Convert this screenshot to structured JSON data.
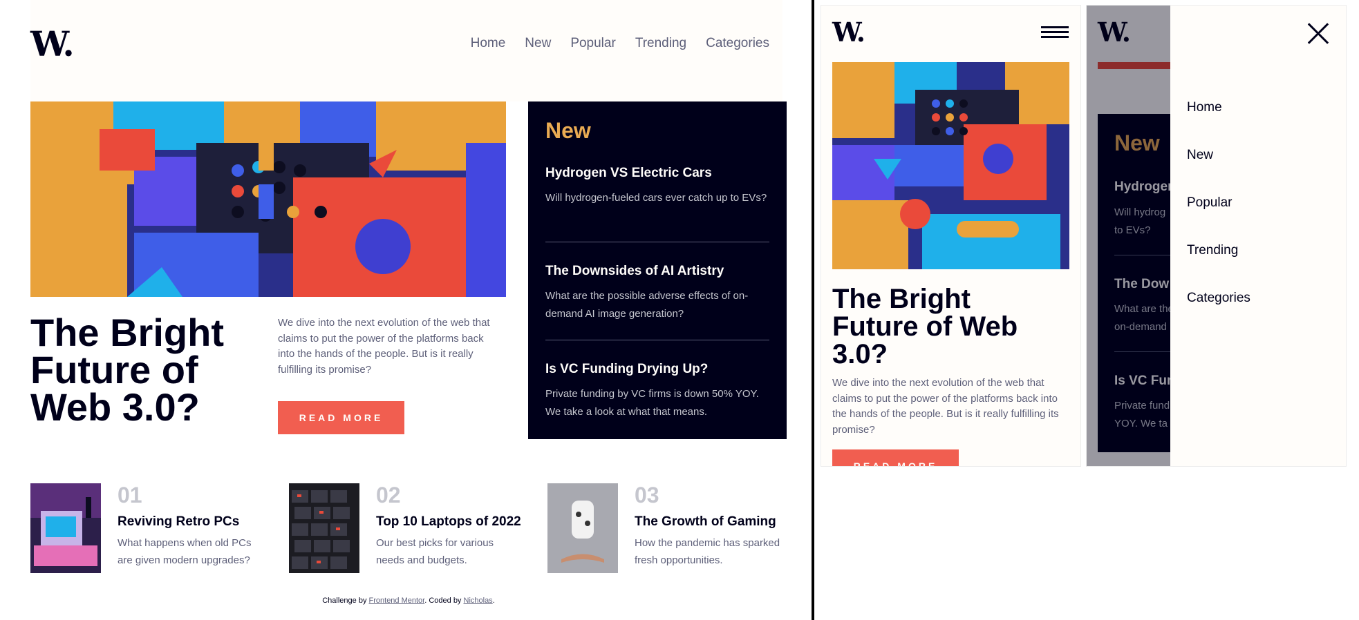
{
  "brand": {
    "logo": "W."
  },
  "nav": [
    "Home",
    "New",
    "Popular",
    "Trending",
    "Categories"
  ],
  "hero": {
    "title": "The Bright Future of Web 3.0?",
    "description": "We dive into the next evolution of the web that claims to put the power of the platforms back into the hands of the people. But is it really fulfilling its promise?",
    "button": "READ MORE"
  },
  "new_section": {
    "heading": "New",
    "items": [
      {
        "title": "Hydrogen VS Electric Cars",
        "text": "Will hydrogen-fueled cars ever catch up to EVs?"
      },
      {
        "title": "The Downsides of AI Artistry",
        "text": "What are the possible adverse effects of on-demand AI image generation?"
      },
      {
        "title": "Is VC Funding Drying Up?",
        "text": "Private funding by VC firms is down 50% YOY. We take a look at what that means."
      }
    ]
  },
  "cards": [
    {
      "num": "01",
      "title": "Reviving Retro PCs",
      "text": "What happens when old PCs are given modern upgrades?"
    },
    {
      "num": "02",
      "title": "Top 10 Laptops of 2022",
      "text": "Our best picks for various needs and budgets."
    },
    {
      "num": "03",
      "title": "The Growth of Gaming",
      "text": "How the pandemic has sparked fresh opportunities."
    }
  ],
  "footer": {
    "prefix": "Challenge by ",
    "mentor": "Frontend Mentor",
    "middle": ". Coded by ",
    "author": "Nicholas",
    "suffix": "."
  },
  "mobile_partial": {
    "new_heading": "New",
    "hydrogen": "Hydrogen",
    "hydrogen_text1": "Will hydrog",
    "hydrogen_text2": "to EVs?",
    "downsides": "The Dow",
    "downsides_text1": "What are the",
    "downsides_text2": "on-demand",
    "vc": "Is VC Fun",
    "vc_text1": "Private fund",
    "vc_text2": "YOY. We ta"
  },
  "colors": {
    "orange": "#e9ab53",
    "red": "#f15e50",
    "dark": "#00001a",
    "offwhite": "#fffdfa",
    "grayblue": "#5d5f79"
  }
}
